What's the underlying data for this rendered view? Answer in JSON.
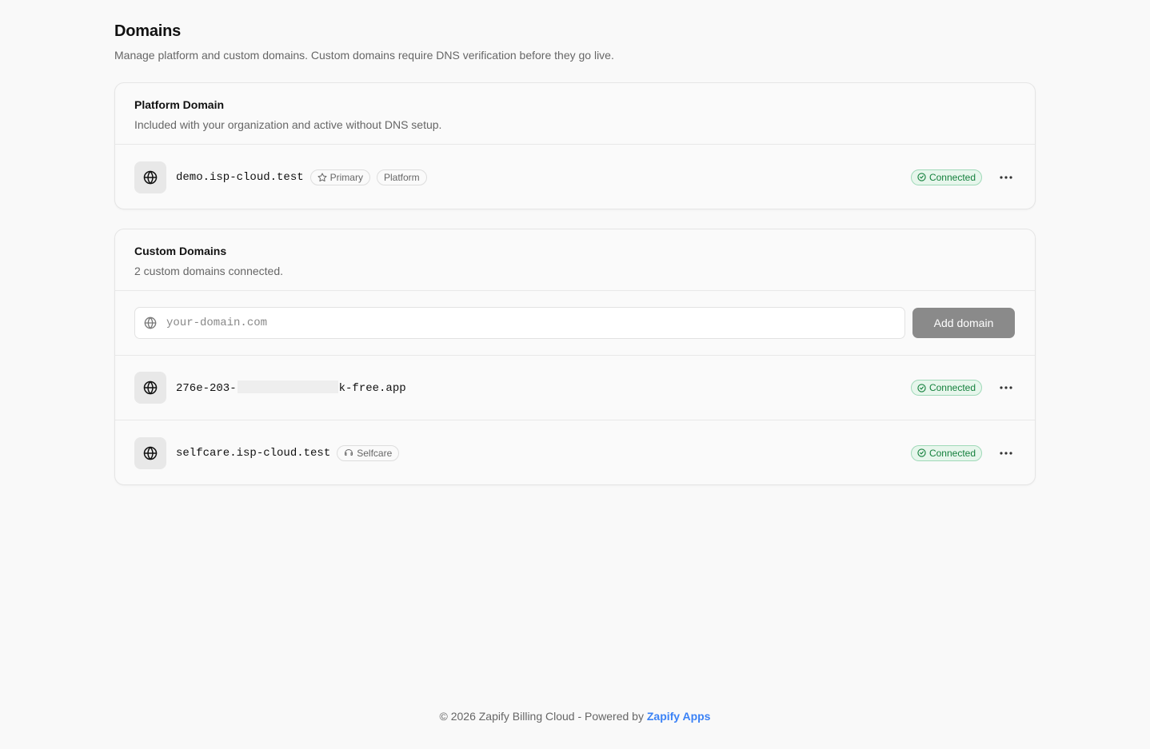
{
  "page": {
    "title": "Domains",
    "subtitle": "Manage platform and custom domains. Custom domains require DNS verification before they go live."
  },
  "platform_card": {
    "title": "Platform Domain",
    "description": "Included with your organization and active without DNS setup.",
    "domain": {
      "name": "demo.isp-cloud.test",
      "tags": [
        {
          "label": "Primary",
          "icon": "star-icon"
        },
        {
          "label": "Platform"
        }
      ],
      "status": "Connected"
    }
  },
  "custom_card": {
    "title": "Custom Domains",
    "description": "2 custom domains connected.",
    "input_placeholder": "your-domain.com",
    "add_button": "Add domain",
    "domains": [
      {
        "name_prefix": "276e-203-",
        "name_suffix": "k-free.app",
        "status": "Connected"
      },
      {
        "name": "selfcare.isp-cloud.test",
        "tag": {
          "label": "Selfcare",
          "icon": "headset-icon"
        },
        "status": "Connected"
      }
    ]
  },
  "footer": {
    "text": "© 2026 Zapify Billing Cloud - Powered by",
    "link": "Zapify Apps"
  },
  "colors": {
    "background": "#f9f9f9",
    "status_green": "#15803d",
    "status_bg": "#e7f6ec",
    "link_blue": "#3b82f6",
    "add_button_bg": "#8a8a8a"
  }
}
